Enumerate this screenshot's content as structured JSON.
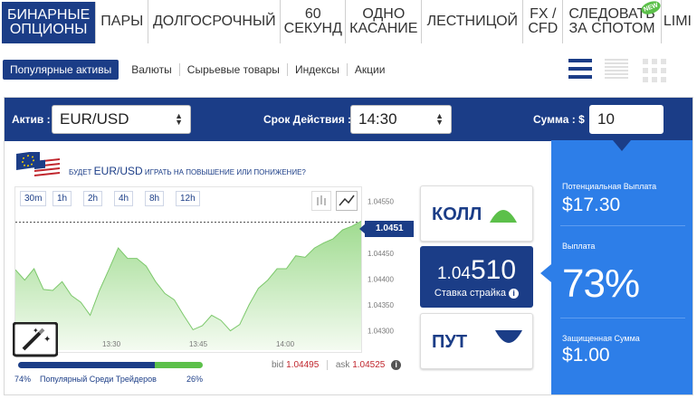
{
  "tabs": [
    {
      "line1": "БИНАРНЫЕ",
      "line2": "ОПЦИОНЫ",
      "active": true
    },
    {
      "line1": "ПАРЫ",
      "line2": ""
    },
    {
      "line1": "ДОЛГОСРОЧНЫЙ",
      "line2": ""
    },
    {
      "line1": "60",
      "line2": "СЕКУНД"
    },
    {
      "line1": "ОДНО",
      "line2": "КАСАНИЕ"
    },
    {
      "line1": "ЛЕСТНИЦОЙ",
      "line2": ""
    },
    {
      "line1": "FX /",
      "line2": "CFD"
    },
    {
      "line1": "СЛЕДОВАТЬ",
      "line2": "ЗА СПОТОМ"
    },
    {
      "line1": "LIMI",
      "line2": ""
    }
  ],
  "new_badge": "NEW",
  "subnav": {
    "popular": "Популярные активы",
    "items": [
      "Валюты",
      "Сырьевые товары",
      "Индексы",
      "Акции"
    ]
  },
  "bar": {
    "asset_label": "Актив :",
    "asset_value": "EUR/USD",
    "expiry_label": "Срок Действия :",
    "expiry_value": "14:30",
    "amount_label": "Сумма : $",
    "amount_value": "10"
  },
  "question": {
    "prefix": "Будет",
    "asset": "EUR/USD",
    "suffix": "играть на повышение или понижение?"
  },
  "timeframes": [
    "30m",
    "1h",
    "2h",
    "4h",
    "8h",
    "12h"
  ],
  "chart_data": {
    "type": "area",
    "x_ticks": [
      "13:30",
      "13:45",
      "14:00"
    ],
    "y_ticks": [
      "1.04550",
      "1.04500",
      "1.04450",
      "1.04400",
      "1.04350",
      "1.04300"
    ],
    "ylim": [
      1.0428,
      1.0456
    ],
    "current_price": "1.0451",
    "values": [
      1.04418,
      1.04398,
      1.0442,
      1.0438,
      1.04378,
      1.04395,
      1.04368,
      1.04355,
      1.0433,
      1.04378,
      1.04418,
      1.0446,
      1.0444,
      1.0444,
      1.04425,
      1.04395,
      1.04372,
      1.0436,
      1.0433,
      1.04302,
      1.0431,
      1.0433,
      1.0432,
      1.043,
      1.04312,
      1.0435,
      1.04382,
      1.04398,
      1.0442,
      1.0442,
      1.04445,
      1.04442,
      1.0446,
      1.0447,
      1.04478,
      1.04495,
      1.04502,
      1.04512
    ]
  },
  "call": {
    "label": "КОЛЛ"
  },
  "put": {
    "label": "ПУТ"
  },
  "strike": {
    "prefix": "1.04",
    "main": "510",
    "label": "Ставка страйка"
  },
  "bid": {
    "label": "bid",
    "value": "1.04495"
  },
  "ask": {
    "label": "ask",
    "value": "1.04525"
  },
  "popular_traders": {
    "left_pct": "74%",
    "text": "Популярный Среди Трейдеров",
    "right_pct": "26%",
    "fraction": 0.74
  },
  "payout_panel": {
    "potential_label": "Потенциальная Выплата",
    "potential_value": "$17.30",
    "payout_label": "Выплата",
    "payout_value": "73%",
    "protected_label": "Защищенная Сумма",
    "protected_value": "$1.00"
  },
  "colors": {
    "primary": "#1b3d87",
    "accent": "#2d7ee8",
    "up": "#5cc04a",
    "down": "#1b3d87",
    "bid": "#c0262d"
  }
}
